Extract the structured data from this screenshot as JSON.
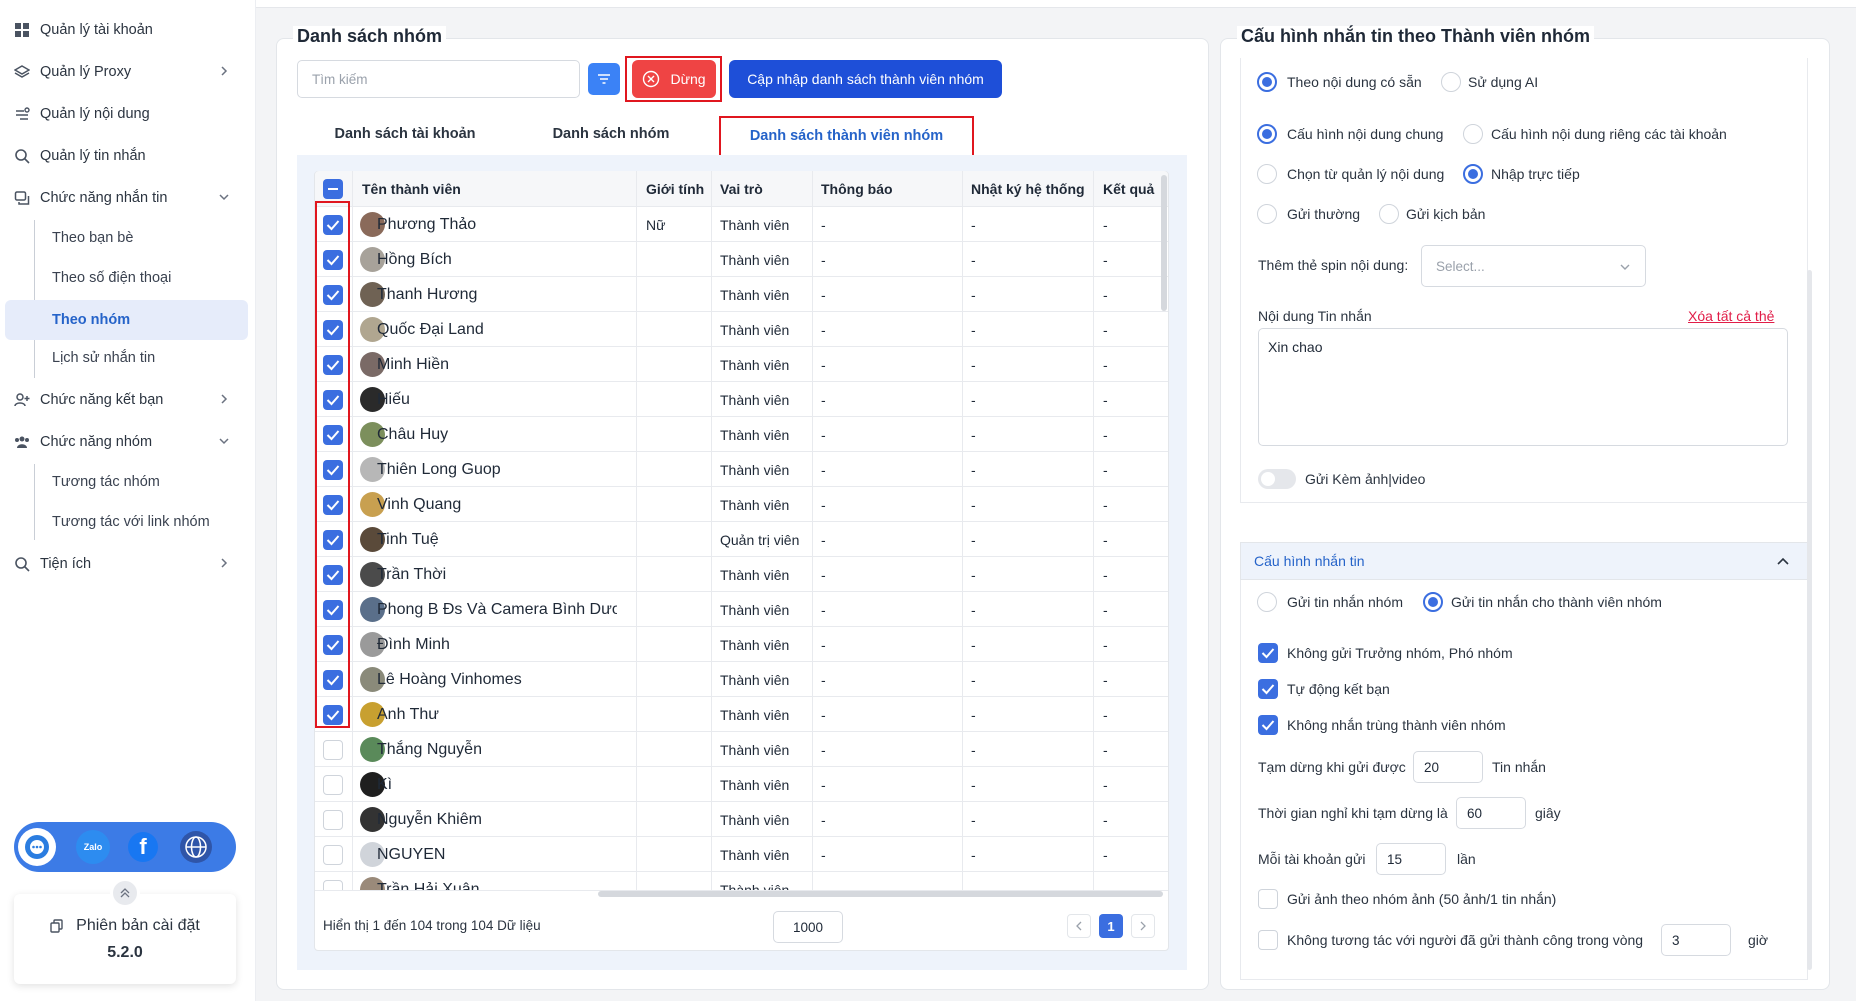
{
  "sidebar": {
    "items": [
      {
        "label": "Quản lý tài khoản",
        "icon": "grid-icon"
      },
      {
        "label": "Quản lý Proxy",
        "icon": "layers-icon"
      },
      {
        "label": "Quản lý nội dung",
        "icon": "content-icon"
      },
      {
        "label": "Quản lý tin nhắn",
        "icon": "search-message-icon"
      },
      {
        "label": "Chức năng nhắn tin",
        "icon": "chat-icon"
      },
      {
        "label": "Chức năng kết bạn",
        "icon": "add-friend-icon"
      },
      {
        "label": "Chức năng nhóm",
        "icon": "group-icon"
      },
      {
        "label": "Tiện ích",
        "icon": "utility-icon"
      }
    ],
    "messaging_sub": [
      "Theo bạn bè",
      "Theo số điện thoại",
      "Theo nhóm",
      "Lịch sử nhắn tin"
    ],
    "group_sub": [
      "Tương tác nhóm",
      "Tương tác với link nhóm"
    ],
    "social": {
      "zalo": "Zalo",
      "facebook": "f"
    },
    "version_label": "Phiên bản cài đặt",
    "version": "5.2.0"
  },
  "left": {
    "title": "Danh sách nhóm",
    "search_placeholder": "Tìm kiếm",
    "stop_label": "Dừng",
    "update_label": "Cập nhập danh sách thành viên nhóm",
    "tabs": [
      "Danh sách tài khoản",
      "Danh sách nhóm",
      "Danh sách thành viên nhóm"
    ],
    "columns": [
      "Tên thành viên",
      "Giới tính",
      "Vai trò",
      "Thông báo",
      "Nhật ký hệ thống",
      "Kết quả"
    ],
    "rows": [
      {
        "name": "Phương Thảo",
        "gender": "Nữ",
        "role": "Thành viên",
        "notice": "-",
        "log": "-",
        "result": "-",
        "checked": true,
        "color": "#8a6a5a"
      },
      {
        "name": "Hồng Bích",
        "gender": "",
        "role": "Thành viên",
        "notice": "-",
        "log": "-",
        "result": "-",
        "checked": true,
        "color": "#a7a29a"
      },
      {
        "name": "Thanh Hương",
        "gender": "",
        "role": "Thành viên",
        "notice": "-",
        "log": "-",
        "result": "-",
        "checked": true,
        "color": "#6f6254"
      },
      {
        "name": "Quốc Đại Land",
        "gender": "",
        "role": "Thành viên",
        "notice": "-",
        "log": "-",
        "result": "-",
        "checked": true,
        "color": "#b0a690"
      },
      {
        "name": "Minh Hiền",
        "gender": "",
        "role": "Thành viên",
        "notice": "-",
        "log": "-",
        "result": "-",
        "checked": true,
        "color": "#7a6a66"
      },
      {
        "name": "Hiếu",
        "gender": "",
        "role": "Thành viên",
        "notice": "-",
        "log": "-",
        "result": "-",
        "checked": true,
        "color": "#2a2a2a"
      },
      {
        "name": "Châu Huy",
        "gender": "",
        "role": "Thành viên",
        "notice": "-",
        "log": "-",
        "result": "-",
        "checked": true,
        "color": "#7c8f5c"
      },
      {
        "name": "Thiên Long Guop",
        "gender": "",
        "role": "Thành viên",
        "notice": "-",
        "log": "-",
        "result": "-",
        "checked": true,
        "color": "#b7b7b7"
      },
      {
        "name": "Vinh Quang",
        "gender": "",
        "role": "Thành viên",
        "notice": "-",
        "log": "-",
        "result": "-",
        "checked": true,
        "color": "#c8a050"
      },
      {
        "name": "Tinh Tuệ",
        "gender": "",
        "role": "Quản trị viên",
        "notice": "-",
        "log": "-",
        "result": "-",
        "checked": true,
        "color": "#5a4a3a"
      },
      {
        "name": "Trần Thời",
        "gender": "",
        "role": "Thành viên",
        "notice": "-",
        "log": "-",
        "result": "-",
        "checked": true,
        "color": "#4b4b4b"
      },
      {
        "name": "Phong B Đs Và Camera Bình Dươn",
        "gender": "",
        "role": "Thành viên",
        "notice": "-",
        "log": "-",
        "result": "-",
        "checked": true,
        "color": "#5a6f8a"
      },
      {
        "name": "Đình Minh",
        "gender": "",
        "role": "Thành viên",
        "notice": "-",
        "log": "-",
        "result": "-",
        "checked": true,
        "color": "#9a9a9a"
      },
      {
        "name": "Lê Hoàng Vinhomes",
        "gender": "",
        "role": "Thành viên",
        "notice": "-",
        "log": "-",
        "result": "-",
        "checked": true,
        "color": "#8a8a7a"
      },
      {
        "name": "Anh Thư",
        "gender": "",
        "role": "Thành viên",
        "notice": "-",
        "log": "-",
        "result": "-",
        "checked": true,
        "color": "#c8a030"
      },
      {
        "name": "Thắng Nguyễn",
        "gender": "",
        "role": "Thành viên",
        "notice": "-",
        "log": "-",
        "result": "-",
        "checked": false,
        "color": "#5a8a5a"
      },
      {
        "name": "Kì",
        "gender": "",
        "role": "Thành viên",
        "notice": "-",
        "log": "-",
        "result": "-",
        "checked": false,
        "color": "#1f1f1f"
      },
      {
        "name": "Nguyễn Khiêm",
        "gender": "",
        "role": "Thành viên",
        "notice": "-",
        "log": "-",
        "result": "-",
        "checked": false,
        "color": "#333333"
      },
      {
        "name": "NGUYEN",
        "gender": "",
        "role": "Thành viên",
        "notice": "-",
        "log": "-",
        "result": "-",
        "checked": false,
        "color": "#d0d4da"
      },
      {
        "name": "Trần Hải Xuân",
        "gender": "",
        "role": "Thành viên",
        "notice": "-",
        "log": "-",
        "result": "-",
        "checked": false,
        "color": "#9a8a7a"
      }
    ],
    "footer_text": "Hiển thị 1 đến 104 trong 104 Dữ liệu",
    "page_size": "1000",
    "current_page": "1"
  },
  "right": {
    "title": "Cấu hình nhắn tin theo Thành viên nhóm",
    "source_options": [
      "Theo nội dung có sẵn",
      "Sử dụng AI"
    ],
    "config_options": [
      "Cấu hình nội dung chung",
      "Cấu hình nội dung riêng các tài khoản"
    ],
    "input_options": [
      "Chọn từ quản lý nội dung",
      "Nhập trực tiếp"
    ],
    "send_options": [
      "Gửi thường",
      "Gửi kịch bản"
    ],
    "spin_label": "Thêm thẻ spin nội dung:",
    "spin_placeholder": "Select...",
    "content_label": "Nội dung Tin nhắn",
    "clear_label": "Xóa tất cả thẻ",
    "message": "Xin chao",
    "attach_label": "Gửi Kèm ảnh|video",
    "section_title": "Cấu hình nhắn tin",
    "target_options": [
      "Gửi tin nhắn nhóm",
      "Gửi tin nhắn cho thành viên nhóm"
    ],
    "checks": [
      "Không gửi Trưởng nhóm, Phó nhóm",
      "Tự động kết bạn",
      "Không nhắn trùng thành viên nhóm"
    ],
    "pause_label": "Tạm dừng khi gửi được",
    "pause_value": "20",
    "pause_unit": "Tin nhắn",
    "rest_label": "Thời gian nghỉ khi tạm dừng là",
    "rest_value": "60",
    "rest_unit": "giây",
    "each_label": "Mỗi tài khoản gửi",
    "each_value": "15",
    "each_unit": "lần",
    "photo_label": "Gửi ảnh theo nhóm ảnh (50 ảnh/1 tin nhắn)",
    "skip_label": "Không tương tác với người đã gửi thành công trong vòng",
    "skip_value": "3",
    "skip_unit": "giờ"
  }
}
